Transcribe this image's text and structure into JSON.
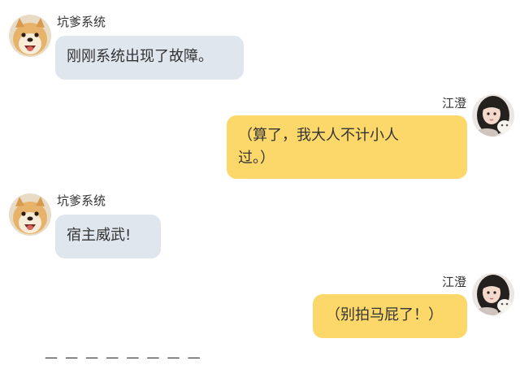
{
  "messages": [
    {
      "sender": "坑爹系统",
      "side": "left",
      "avatar": "shiba-dog-avatar",
      "text": "刚刚系统出现了故障。"
    },
    {
      "sender": "江澄",
      "side": "right",
      "avatar": "girl-portrait-avatar",
      "text_line1": "（算了，我大人不计小人",
      "text_line2": "过。）"
    },
    {
      "sender": "坑爹系统",
      "side": "left",
      "avatar": "shiba-dog-avatar",
      "text": "宿主威武!"
    },
    {
      "sender": "江澄",
      "side": "right",
      "avatar": "girl-portrait-avatar",
      "text": "（别拍马屁了！）"
    }
  ],
  "footer": {
    "dashes": "— — — — — — — —"
  },
  "colors": {
    "incoming_bubble": "#e0e6ee",
    "outgoing_bubble": "#fcd86a",
    "text": "#333333"
  }
}
